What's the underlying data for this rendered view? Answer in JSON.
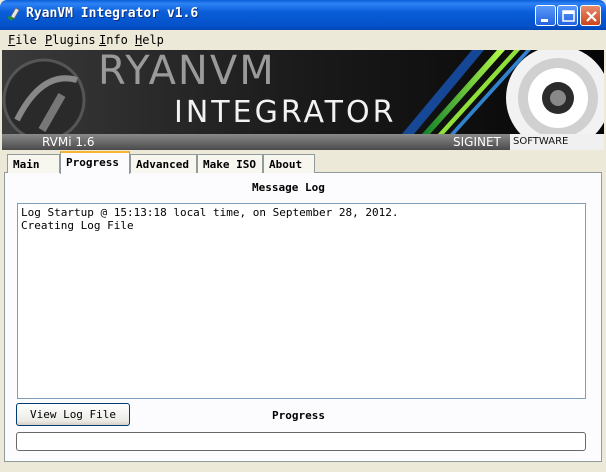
{
  "window": {
    "title": "RyanVM Integrator v1.6"
  },
  "menu": {
    "items": [
      "File",
      "Plugins",
      "Info",
      "Help"
    ]
  },
  "banner": {
    "logo_text_top": "RYANVM",
    "logo_text_bottom": "INTEGRATOR",
    "version": "RVMi 1.6",
    "brand": "SIGINET",
    "brand_suffix": "SOFTWARE"
  },
  "tabs": [
    {
      "label": "Main",
      "active": false
    },
    {
      "label": "Progress",
      "active": true
    },
    {
      "label": "Advanced",
      "active": false
    },
    {
      "label": "Make ISO",
      "active": false
    },
    {
      "label": "About",
      "active": false
    }
  ],
  "message_log": {
    "label": "Message Log",
    "lines": [
      "Log Startup @ 15:13:18 local time, on September 28, 2012.",
      "Creating Log File"
    ]
  },
  "view_log_button": "View Log File",
  "progress": {
    "label": "Progress",
    "value": 0
  },
  "colors": {
    "titlebar": "#0b5ed9",
    "active_tab_accent": "#f7b531",
    "window_bg": "#ece9d8"
  }
}
